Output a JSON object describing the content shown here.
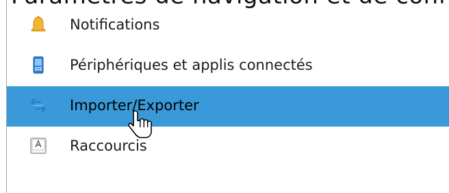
{
  "header": {
    "partial_text": "Paramètres de navigation et de confidentialité"
  },
  "menu": {
    "items": [
      {
        "label": "Notifications",
        "icon": "bell-icon",
        "selected": false
      },
      {
        "label": "Périphériques et applis connectés",
        "icon": "phone-icon",
        "selected": false
      },
      {
        "label": "Importer/Exporter",
        "icon": "import-export-arrows-icon",
        "selected": true
      },
      {
        "label": "Raccourcis",
        "icon": "keyboard-key-icon",
        "selected": false
      }
    ]
  },
  "colors": {
    "selection": "#3a9ad9",
    "bell": "#f2b630",
    "phone": "#2e7fd0",
    "arrows": "#2a7fd4"
  },
  "cursor": {
    "type": "hand-pointer-icon"
  }
}
